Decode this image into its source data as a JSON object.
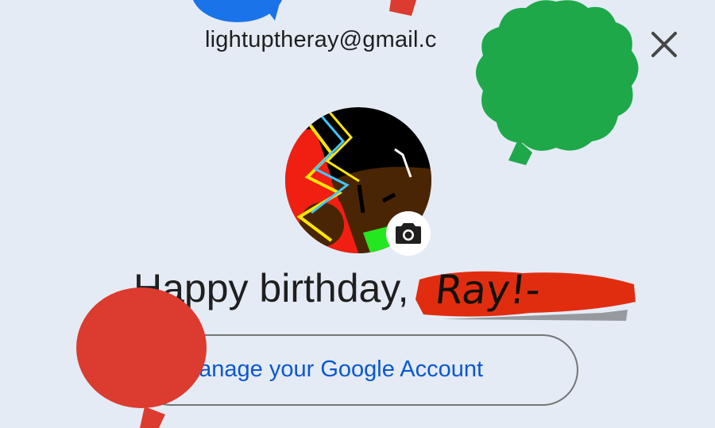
{
  "account": {
    "email": "lightuptheray@gmail.c",
    "greeting": "Happy birthday,",
    "name_handwritten": "Ray!-",
    "manage_label": "Manage your Google Account"
  },
  "icons": {
    "close": "close-icon",
    "camera": "camera-icon"
  },
  "colors": {
    "background": "#e4ebf5",
    "link_blue": "#0b57d0",
    "balloon_green": "#1ea84a",
    "balloon_red": "#dc3b2f",
    "balloon_blue": "#1a73e8",
    "scribble_red": "#e12d0f"
  }
}
